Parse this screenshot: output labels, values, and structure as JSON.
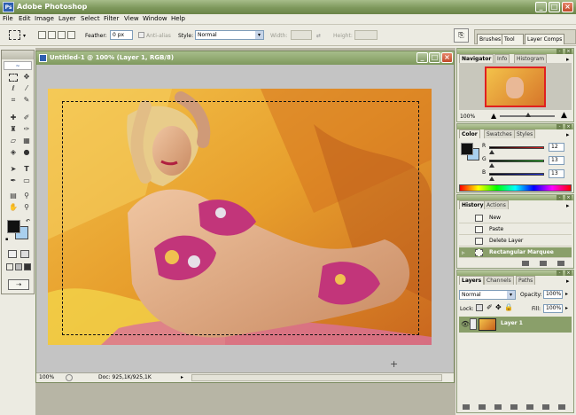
{
  "app": {
    "title": "Adobe Photoshop",
    "logo_text": "Ps"
  },
  "menu": [
    "File",
    "Edit",
    "Image",
    "Layer",
    "Select",
    "Filter",
    "View",
    "Window",
    "Help"
  ],
  "options": {
    "feather_label": "Feather:",
    "feather_value": "0 px",
    "antialias_label": "Anti-alias",
    "style_label": "Style:",
    "style_value": "Normal",
    "width_label": "Width:",
    "height_label": "Height:"
  },
  "palette_well": [
    "Brushes",
    "Tool Presets",
    "Layer Comps"
  ],
  "document": {
    "title": "Untitled-1 @ 100% (Layer 1, RGB/8)",
    "zoom": "100%",
    "doc_info": "Doc: 925,1K/925,1K"
  },
  "navigator": {
    "tabs": [
      "Navigator",
      "Info",
      "Histogram"
    ],
    "zoom": "100%"
  },
  "color": {
    "tabs": [
      "Color",
      "Swatches",
      "Styles"
    ],
    "channels": [
      {
        "label": "R",
        "value": "12"
      },
      {
        "label": "G",
        "value": "13"
      },
      {
        "label": "B",
        "value": "13"
      }
    ]
  },
  "history": {
    "tabs": [
      "History",
      "Actions"
    ],
    "items": [
      "New",
      "Paste",
      "Delete Layer",
      "Rectangular Marquee"
    ]
  },
  "layers": {
    "tabs": [
      "Layers",
      "Channels",
      "Paths"
    ],
    "blend_mode": "Normal",
    "opacity_label": "Opacity:",
    "opacity": "100%",
    "lock_label": "Lock:",
    "fill_label": "Fill:",
    "fill": "100%",
    "layer_name": "Layer 1"
  },
  "colors": {
    "accent": "#7e985c",
    "selected_row": "#8a9f6a"
  }
}
